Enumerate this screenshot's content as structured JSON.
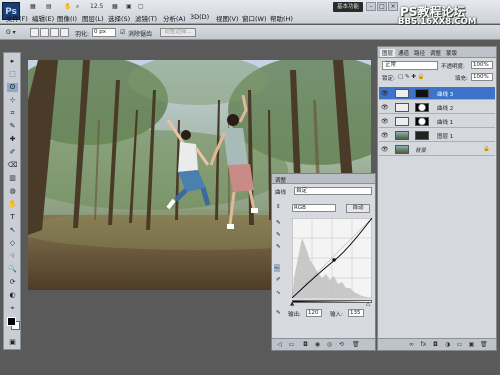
{
  "watermark": {
    "line1": "PS教程论坛",
    "line2": "BBS.16XX8.COM"
  },
  "menubar": {
    "logo": "Ps",
    "items": [
      "文件(F)",
      "编辑(E)",
      "图像(I)",
      "图层(L)",
      "选择(S)",
      "滤镜(T)",
      "分析(A)",
      "3D(D)",
      "视图(V)",
      "窗口(W)",
      "帮助(H)"
    ],
    "zoom": "12.5",
    "workspace_button": "基本功能",
    "window_buttons": [
      "–",
      "□",
      "×"
    ]
  },
  "options_bar": {
    "feather_label": "羽化:",
    "feather_value": "0 px",
    "antialias_label": "消除锯齿",
    "refine_edge_button": "调整边缘..."
  },
  "toolbox": {
    "tools": [
      "▸",
      "⬚",
      "ʘ",
      "⊹",
      "⌗",
      "✎",
      "✚",
      "✐",
      "⌫",
      "▥",
      "◍",
      "✋",
      "T",
      "↖",
      "◇",
      "☟",
      "🔍",
      "⟳",
      "◐",
      "⌖",
      "▣"
    ]
  },
  "layers_panel": {
    "tabs": [
      "图层",
      "通道",
      "路径",
      "调整",
      "蒙版"
    ],
    "blend_mode": "正常",
    "opacity_label": "不透明度:",
    "opacity_value": "100%",
    "lock_label": "锁定:",
    "fill_label": "填充:",
    "fill_value": "100%",
    "layers": [
      {
        "name": "曲线 3",
        "selected": true,
        "thumb": "curve",
        "mask": "dark"
      },
      {
        "name": "曲线 2",
        "selected": false,
        "thumb": "curve",
        "mask": "white-oval"
      },
      {
        "name": "曲线 1",
        "selected": false,
        "thumb": "curve",
        "mask": "white-oval"
      },
      {
        "name": "图层 1",
        "selected": false,
        "thumb": "photo",
        "mask": "dark"
      },
      {
        "name": "背景",
        "selected": false,
        "thumb": "photo",
        "mask": "none"
      }
    ],
    "bottom_icons": [
      "∞",
      "fx",
      "◘",
      "◑",
      "▭",
      "▣",
      "🗑"
    ]
  },
  "curves_panel": {
    "tab": "调整",
    "preset_label": "曲线",
    "preset_value": "自定",
    "channel": "RGB",
    "auto_button": "自动",
    "output_label": "输出:",
    "output_value": "120",
    "input_label": "输入:",
    "input_value": "135",
    "control_point": {
      "input": 135,
      "output": 120
    }
  },
  "colors": {
    "selection": "#3d73c9",
    "chrome": "#cdd2d9",
    "bg": "#5a5a5a"
  }
}
